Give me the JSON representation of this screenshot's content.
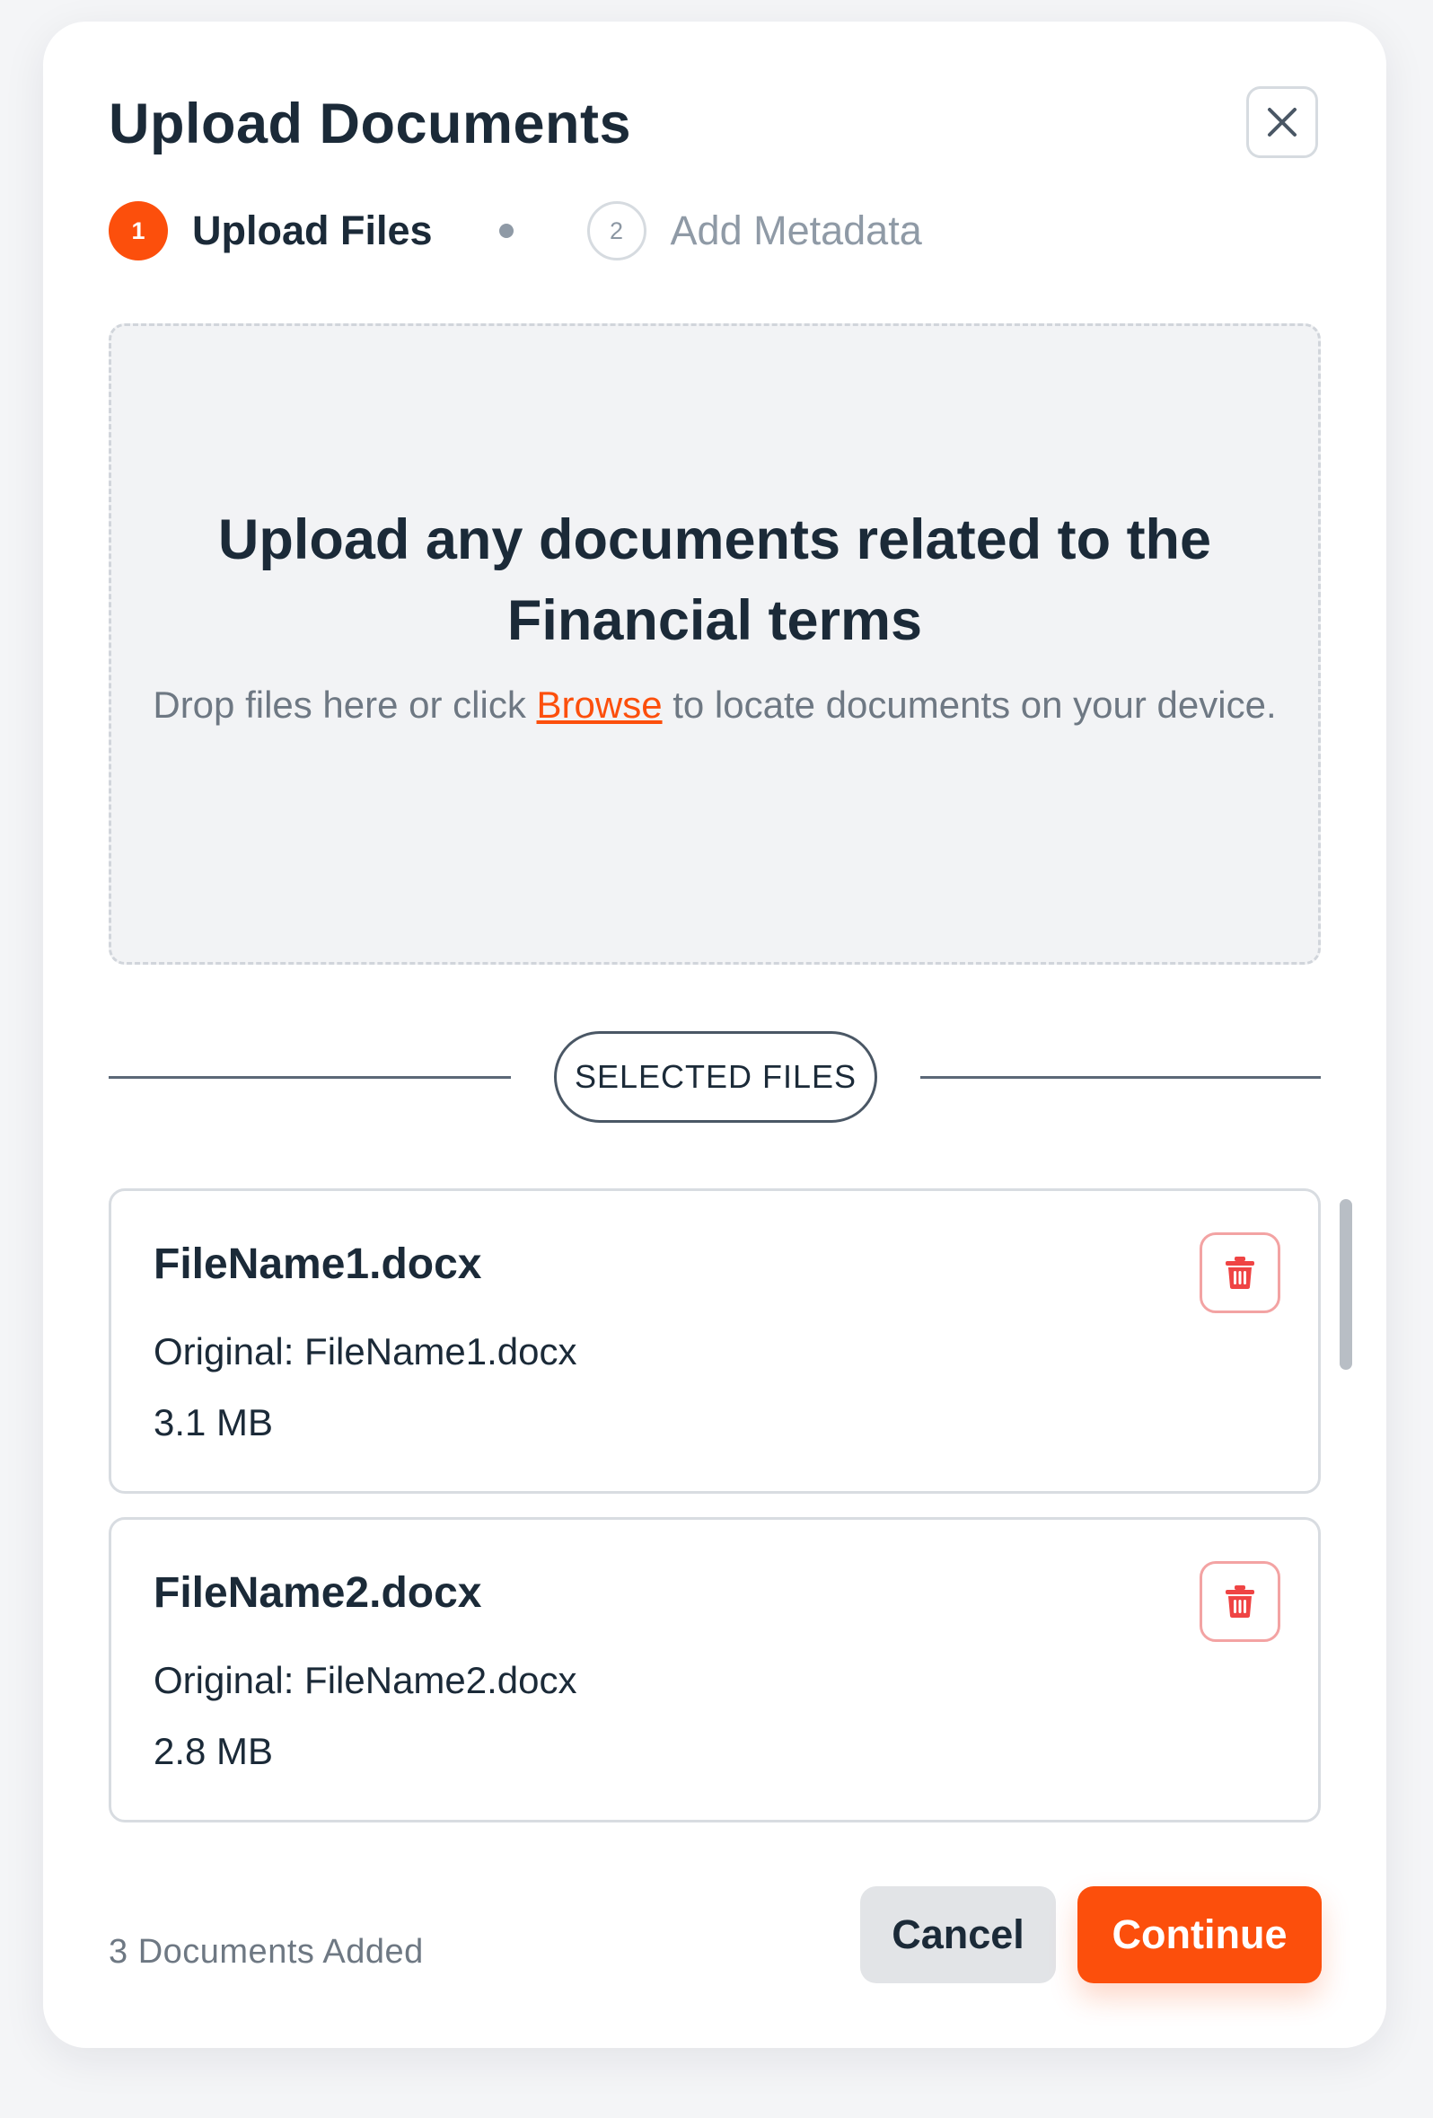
{
  "dialog": {
    "title": "Upload Documents",
    "close_label": "close"
  },
  "stepper": {
    "steps": [
      {
        "number": "1",
        "label": "Upload Files",
        "state": "active"
      },
      {
        "number": "2",
        "label": "Add Metadata",
        "state": "inactive"
      }
    ]
  },
  "dropzone": {
    "heading": "Upload any documents related to the Financial terms",
    "text_before_link": "Drop files here or click ",
    "link_label": "Browse",
    "text_after_link": " to locate documents on your device."
  },
  "selected_files": {
    "divider_label": "SELECTED FILES",
    "files": [
      {
        "name": "FileName1.docx",
        "original": "Original: FileName1.docx",
        "size": "3.1 MB"
      },
      {
        "name": "FileName2.docx",
        "original": "Original: FileName2.docx",
        "size": "2.8 MB"
      }
    ]
  },
  "footer": {
    "count_text": "3 Documents Added",
    "cancel_label": "Cancel",
    "continue_label": "Continue"
  },
  "colors": {
    "accent": "#fc4f0c",
    "text_primary": "#1b2a38",
    "text_muted": "#6e7883",
    "delete_red": "#ef4444"
  },
  "icons": {
    "close": "close-icon",
    "delete": "trash-icon"
  }
}
